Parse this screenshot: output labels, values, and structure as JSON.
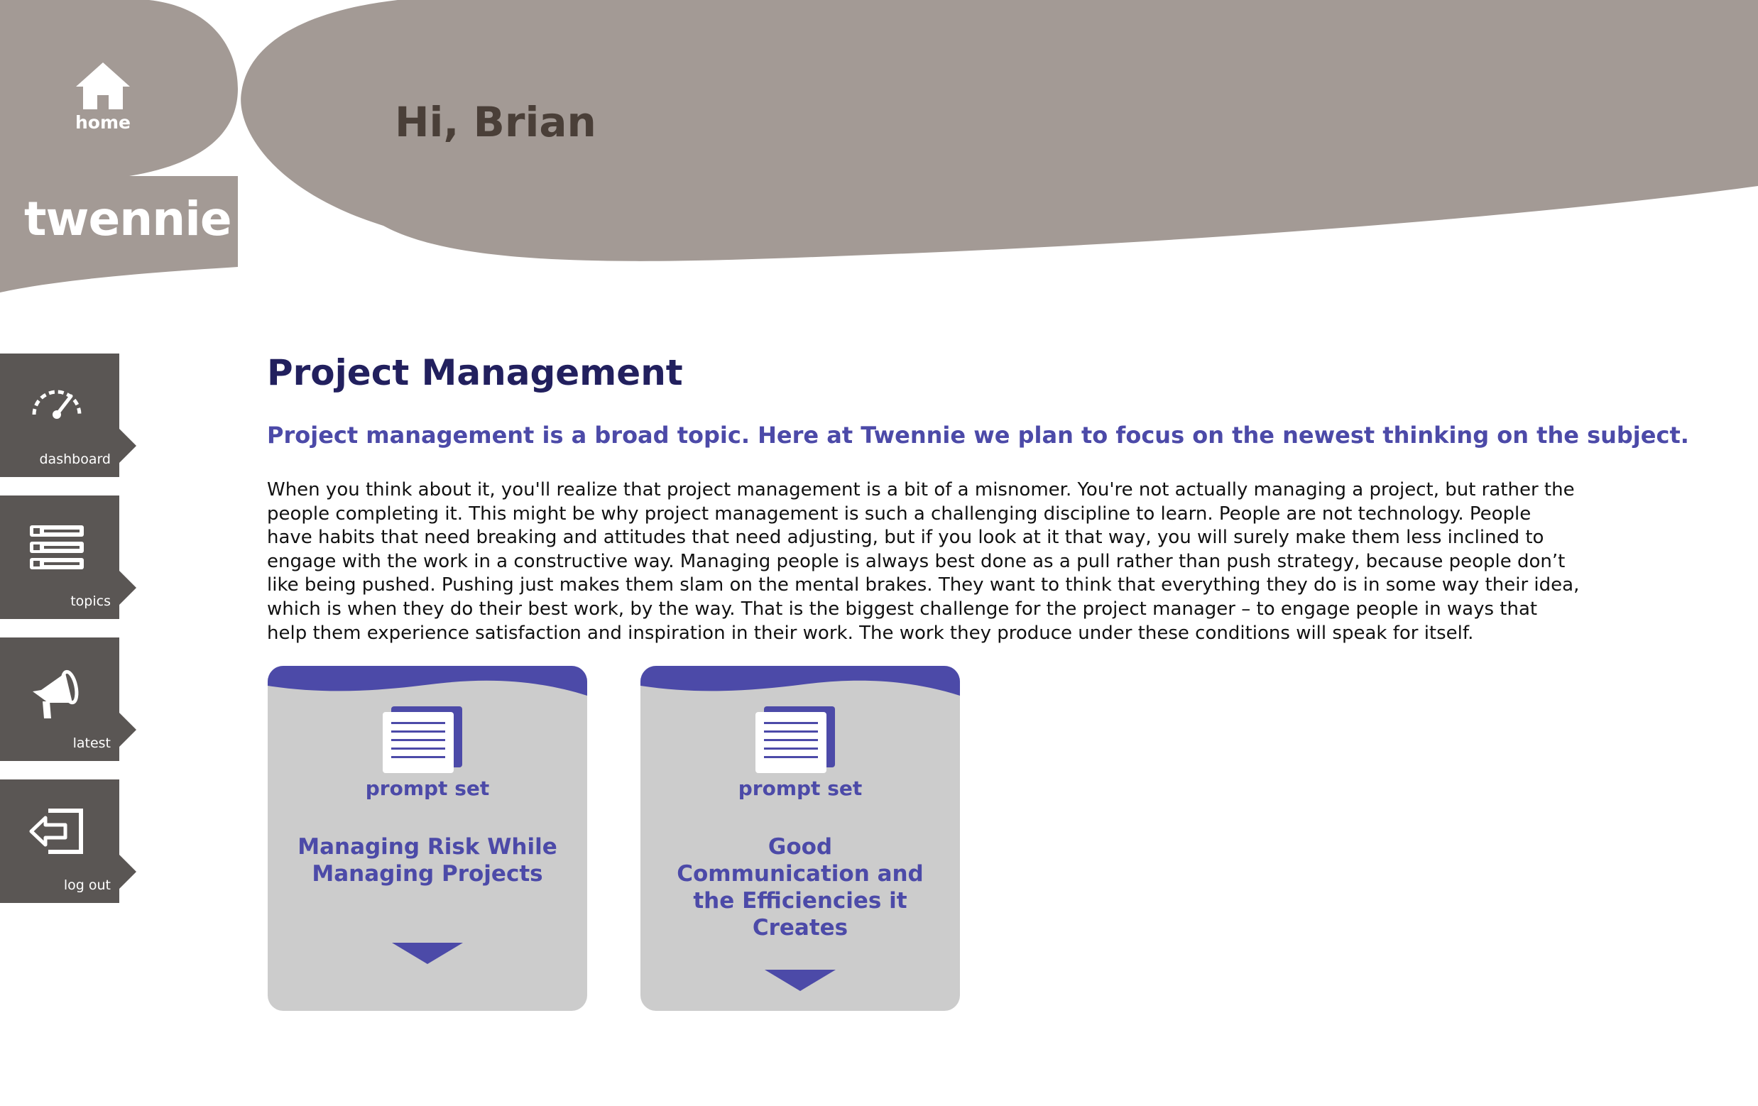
{
  "app": {
    "brand": "twennie",
    "home_label": "home",
    "greeting": "Hi, Brian"
  },
  "colors": {
    "header": "#a39a95",
    "nav": "#5a5654",
    "title": "#22205e",
    "accent": "#4c4aa8",
    "card": "#cccccc"
  },
  "sidebar": {
    "items": [
      {
        "label": "dashboard",
        "icon": "speedometer-icon"
      },
      {
        "label": "topics",
        "icon": "list-icon"
      },
      {
        "label": "latest",
        "icon": "megaphone-icon"
      },
      {
        "label": "log out",
        "icon": "logout-icon"
      }
    ]
  },
  "main": {
    "title": "Project Management",
    "subtitle": "Project management is a broad topic. Here at Twennie we plan to focus on the newest thinking on the subject.",
    "body": "When you think about it, you'll realize that project management is a bit of a misnomer. You're not actually managing a project, but rather the people completing it. This might be why project management is such a challenging discipline to learn. People are not technology. People have habits that need breaking and attitudes that need adjusting, but if you look at it that way, you will surely make them less inclined to engage with the work in a constructive way. Managing people is always best done as a pull rather than push strategy, because people don’t like being pushed. Pushing just makes them slam on the mental brakes. They want to think that everything they do is in some way their idea, which is when they do their best work, by the way. That is the biggest challenge for the project manager – to engage people in ways that help them experience satisfaction and inspiration in their work. The work they produce under these conditions will speak for itself."
  },
  "cards": [
    {
      "type": "prompt set",
      "title": "Managing Risk While Managing Projects",
      "icon": "document-stack-icon"
    },
    {
      "type": "prompt set",
      "title": "Good Communication and the Efficiencies it Creates",
      "icon": "document-stack-icon"
    }
  ]
}
